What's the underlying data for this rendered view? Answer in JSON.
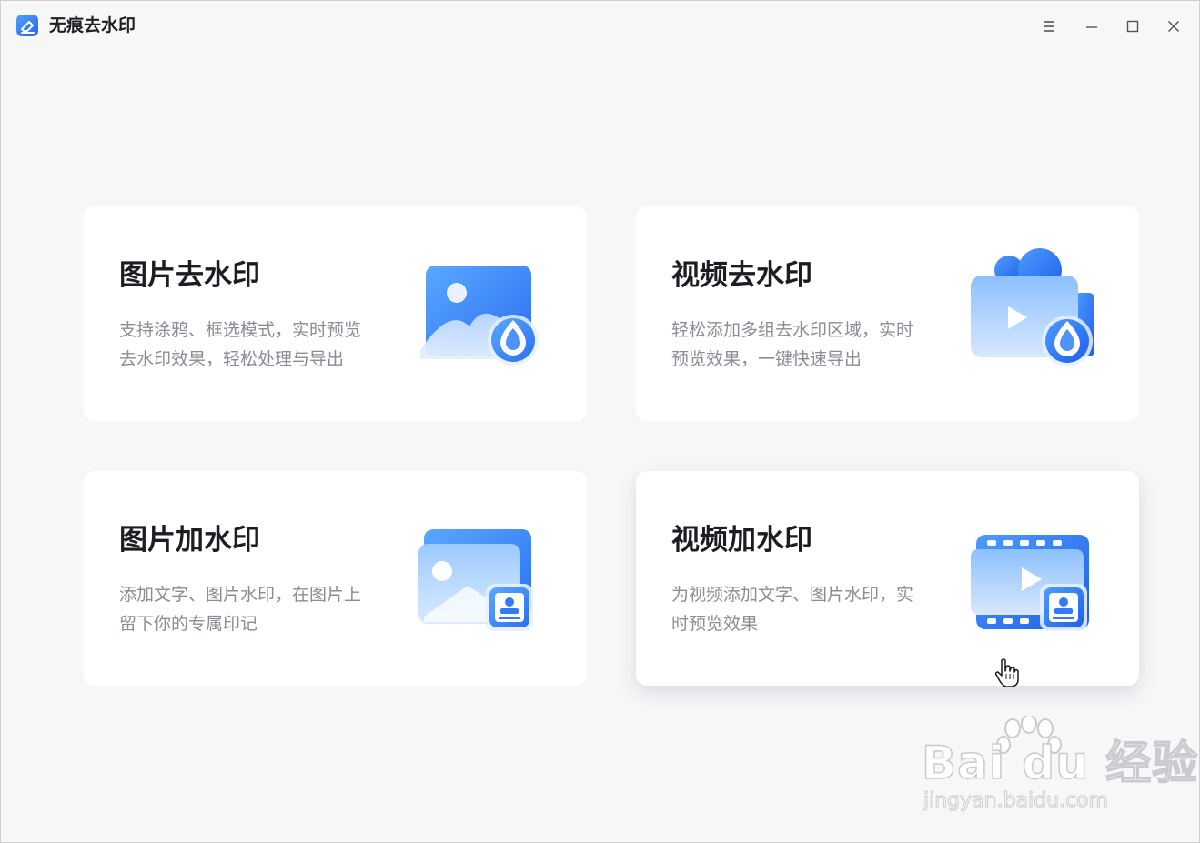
{
  "app": {
    "title": "无痕去水印",
    "icon": "eraser-app-icon"
  },
  "window_controls": {
    "menu": "menu-icon",
    "minimize": "minimize-icon",
    "maximize": "maximize-icon",
    "close": "close-icon"
  },
  "cards": [
    {
      "title": "图片去水印",
      "desc_line1": "支持涂鸦、框选模式，实时预览",
      "desc_line2": "去水印效果，轻松处理与导出",
      "icon": "image-remove-watermark-icon"
    },
    {
      "title": "视频去水印",
      "desc_line1": "轻松添加多组去水印区域，实时",
      "desc_line2": "预览效果，一键快速导出",
      "icon": "video-remove-watermark-icon"
    },
    {
      "title": "图片加水印",
      "desc_line1": "添加文字、图片水印，在图片上",
      "desc_line2": "留下你的专属印记",
      "icon": "image-add-watermark-icon"
    },
    {
      "title": "视频加水印",
      "desc_line1": "为视频添加文字、图片水印，实",
      "desc_line2": "时预览效果",
      "icon": "video-add-watermark-icon"
    }
  ],
  "watermark": {
    "brand": "Bai du 经验",
    "url": "jingyan.baidu.com"
  },
  "colors": {
    "accent": "#2f7cf6",
    "accent_light": "#7fb5ff",
    "background": "#f7f7f8",
    "card": "#ffffff",
    "title_text": "#1c1c22",
    "desc_text": "#8a8d95"
  }
}
